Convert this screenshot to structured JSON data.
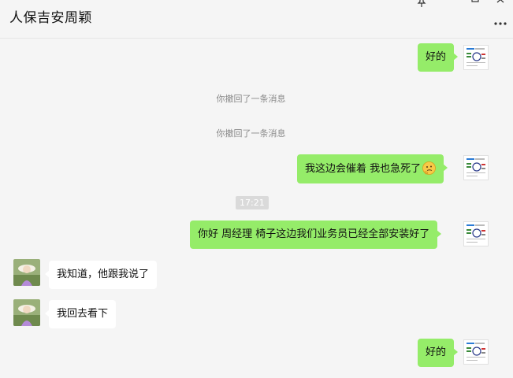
{
  "window": {
    "title": "人保吉安周颖",
    "pin_icon": "pin-icon",
    "minimize_icon": "minimize-icon",
    "maximize_icon": "maximize-icon",
    "close_icon": "close-icon",
    "more_icon": "more-icon"
  },
  "messages": [
    {
      "from": "me",
      "text": "好的"
    },
    {
      "system": "你撤回了一条消息"
    },
    {
      "system": "你撤回了一条消息"
    },
    {
      "from": "me",
      "text": "我这边会催着  我也急死了",
      "emoji": "thinking-face-icon"
    },
    {
      "time": "17:21"
    },
    {
      "from": "me",
      "text": "你好 周经理 椅子这边我们业务员已经全部安装好了"
    },
    {
      "from": "other",
      "text": "我知道，他跟我说了"
    },
    {
      "from": "other",
      "text": "我回去看下"
    },
    {
      "from": "me",
      "text": "好的"
    }
  ],
  "colors": {
    "me_bubble": "#95ec69",
    "other_bubble": "#ffffff",
    "background": "#f5f5f5"
  }
}
